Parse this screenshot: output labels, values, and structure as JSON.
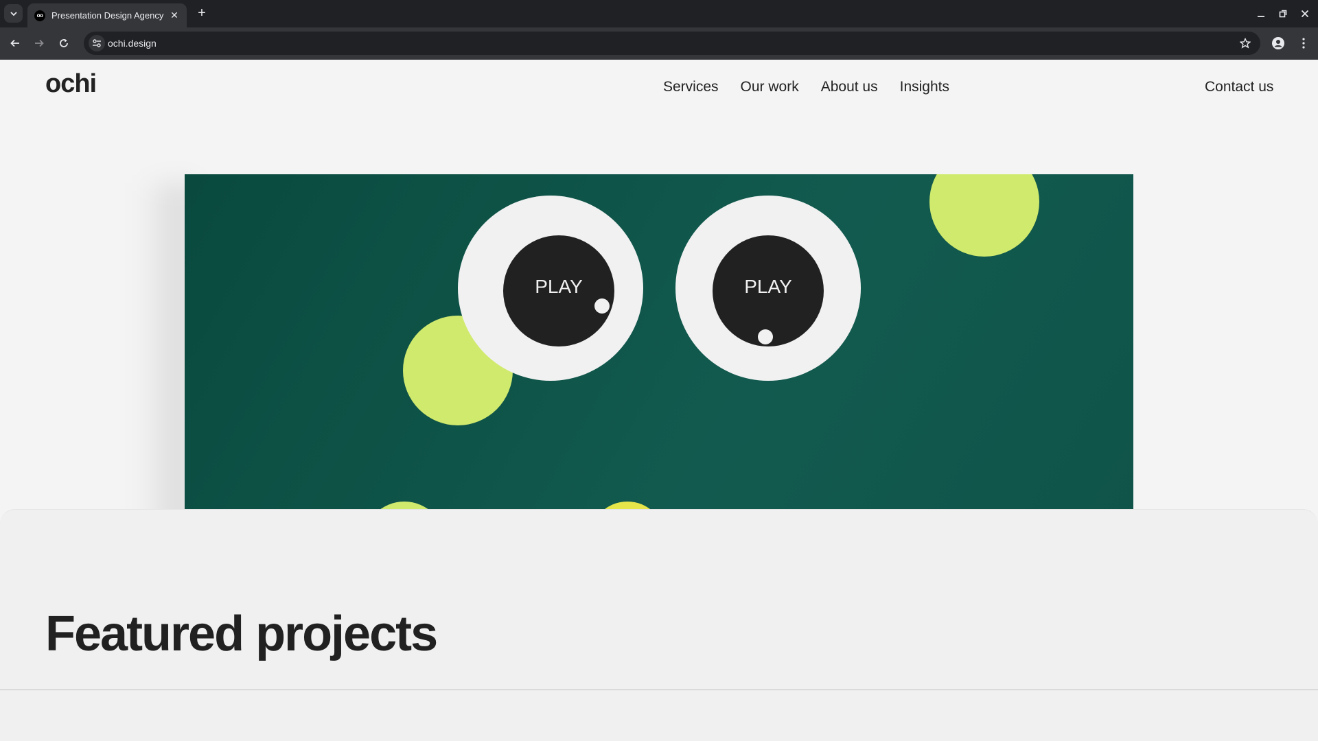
{
  "browser": {
    "tab": {
      "favicon_text": "oo",
      "title": "Presentation Design Agency",
      "close_glyph": "✕"
    },
    "new_tab_glyph": "+",
    "url": "ochi.design"
  },
  "site": {
    "logo": "ochi",
    "nav": [
      {
        "label": "Services"
      },
      {
        "label": "Our work"
      },
      {
        "label": "About us"
      },
      {
        "label": "Insights"
      }
    ],
    "contact_label": "Contact us"
  },
  "hero": {
    "background_color": "#0d4f43",
    "accent_color": "#d0ea6d",
    "left_eye_label": "PLAY",
    "right_eye_label": "PLAY"
  },
  "featured": {
    "title": "Featured projects"
  }
}
